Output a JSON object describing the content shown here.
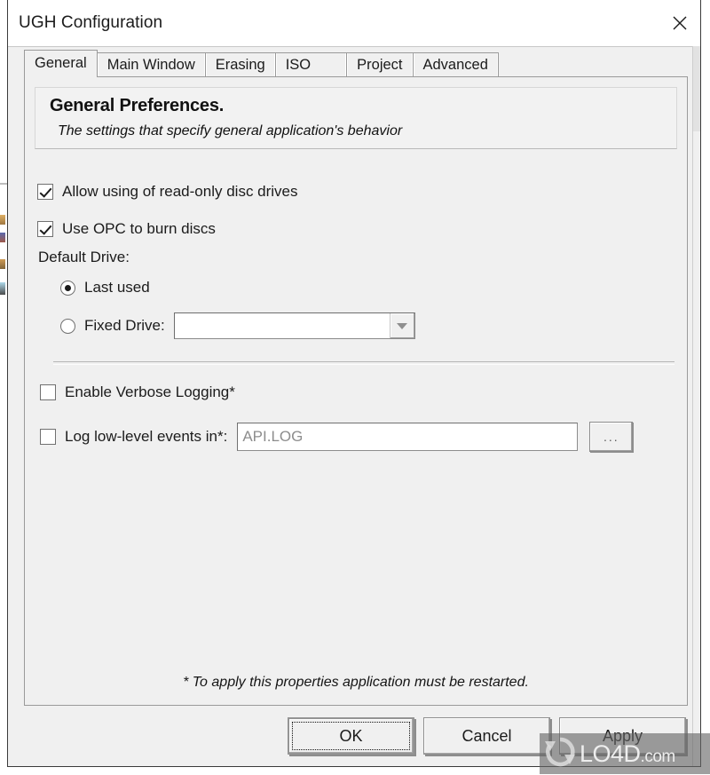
{
  "window": {
    "title": "UGH Configuration",
    "close_icon": "close-x-icon"
  },
  "tabs": [
    {
      "label": "General",
      "active": true
    },
    {
      "label": "Main Window",
      "active": false
    },
    {
      "label": "Erasing",
      "active": false
    },
    {
      "label": "ISO",
      "active": false
    },
    {
      "label": "Project",
      "active": false
    },
    {
      "label": "Advanced",
      "active": false
    }
  ],
  "header": {
    "title": "General Preferences.",
    "subtitle": "The settings that specify general application's behavior"
  },
  "options": {
    "allow_readonly": {
      "label": "Allow using of read-only disc drives",
      "checked": true
    },
    "use_opc": {
      "label": "Use OPC to burn discs",
      "checked": true
    },
    "default_drive": {
      "group_label": "Default Drive:",
      "last_used": {
        "label": "Last used",
        "selected": true
      },
      "fixed_drive": {
        "label": "Fixed Drive:",
        "selected": false
      },
      "drive_combo": {
        "value": "",
        "arrow_icon": "chevron-down-icon"
      }
    },
    "verbose_logging": {
      "label": "Enable Verbose Logging*",
      "checked": false
    },
    "low_level_log": {
      "label": "Log low-level events in*:",
      "checked": false,
      "path_value": "API.LOG",
      "browse_label": "..."
    }
  },
  "footnote": "* To apply this properties application must be restarted.",
  "buttons": {
    "ok": "OK",
    "cancel": "Cancel",
    "apply": "Apply"
  },
  "watermark": {
    "text": "LO4D",
    "domain": ".com",
    "logo_icon": "refresh-circle-icon"
  },
  "colors": {
    "dialog_face": "#f0f0f0",
    "titlebar": "#ffffff",
    "border": "#3b3b3b",
    "text": "#1b1b1b",
    "placeholder_text": "#8d8d8d",
    "control_border": "#8a8a8a"
  }
}
